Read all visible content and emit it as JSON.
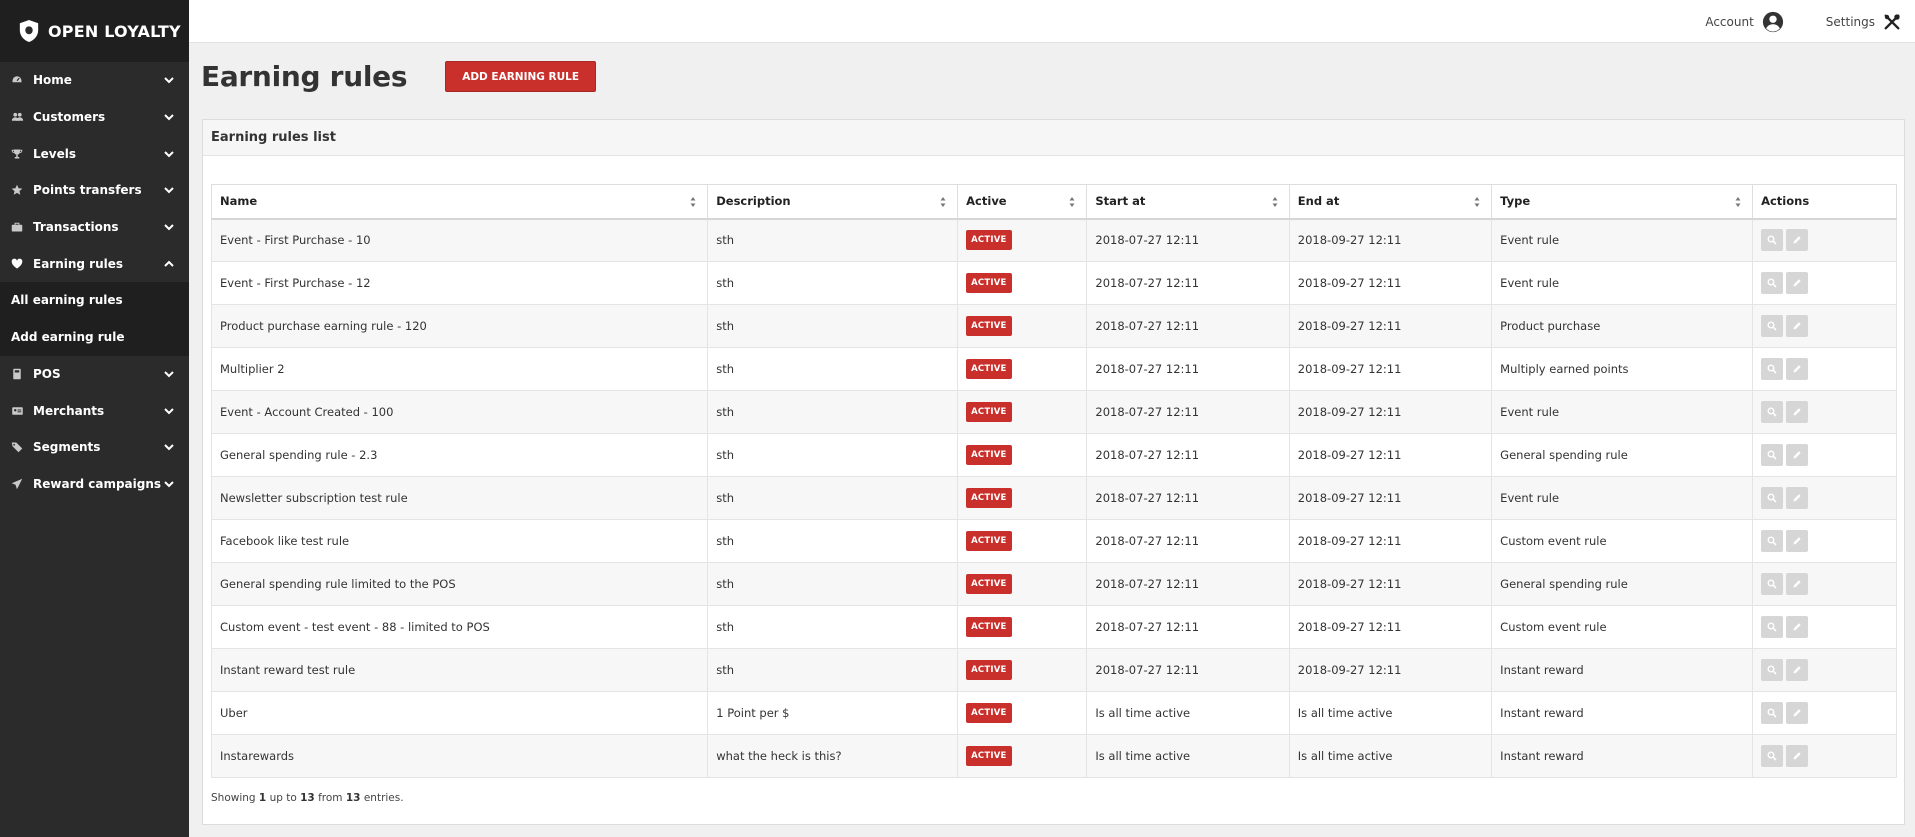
{
  "brand": {
    "name": "OPEN LOYALTY"
  },
  "colors": {
    "accent": "#c9302c",
    "sidebar_bg": "#2b2b2b",
    "sidebar_active_bg": "#1f1f1f"
  },
  "topbar": {
    "account_label": "Account",
    "settings_label": "Settings"
  },
  "sidebar": {
    "items": [
      {
        "label": "Home",
        "icon": "dashboard-icon"
      },
      {
        "label": "Customers",
        "icon": "users-icon"
      },
      {
        "label": "Levels",
        "icon": "trophy-icon"
      },
      {
        "label": "Points transfers",
        "icon": "star-icon"
      },
      {
        "label": "Transactions",
        "icon": "briefcase-icon"
      },
      {
        "label": "Earning rules",
        "icon": "heart-icon",
        "expanded": true
      },
      {
        "label": "POS",
        "icon": "pos-icon"
      },
      {
        "label": "Merchants",
        "icon": "id-card-icon"
      },
      {
        "label": "Segments",
        "icon": "tags-icon"
      },
      {
        "label": "Reward campaigns",
        "icon": "paper-plane-icon"
      }
    ],
    "subitems": [
      {
        "label": "All earning rules"
      },
      {
        "label": "Add earning rule"
      }
    ]
  },
  "page": {
    "title": "Earning rules",
    "add_button": "ADD EARNING RULE"
  },
  "panel": {
    "title": "Earning rules list"
  },
  "table": {
    "columns": [
      "Name",
      "Description",
      "Active",
      "Start at",
      "End at",
      "Type",
      "Actions"
    ],
    "rows": [
      {
        "name": "Event - First Purchase - 10",
        "description": "sth",
        "active": "ACTIVE",
        "start": "2018-07-27 12:11",
        "end": "2018-09-27 12:11",
        "type": "Event rule"
      },
      {
        "name": "Event - First Purchase - 12",
        "description": "sth",
        "active": "ACTIVE",
        "start": "2018-07-27 12:11",
        "end": "2018-09-27 12:11",
        "type": "Event rule"
      },
      {
        "name": "Product purchase earning rule - 120",
        "description": "sth",
        "active": "ACTIVE",
        "start": "2018-07-27 12:11",
        "end": "2018-09-27 12:11",
        "type": "Product purchase"
      },
      {
        "name": "Multiplier 2",
        "description": "sth",
        "active": "ACTIVE",
        "start": "2018-07-27 12:11",
        "end": "2018-09-27 12:11",
        "type": "Multiply earned points"
      },
      {
        "name": "Event - Account Created - 100",
        "description": "sth",
        "active": "ACTIVE",
        "start": "2018-07-27 12:11",
        "end": "2018-09-27 12:11",
        "type": "Event rule"
      },
      {
        "name": "General spending rule - 2.3",
        "description": "sth",
        "active": "ACTIVE",
        "start": "2018-07-27 12:11",
        "end": "2018-09-27 12:11",
        "type": "General spending rule"
      },
      {
        "name": "Newsletter subscription test rule",
        "description": "sth",
        "active": "ACTIVE",
        "start": "2018-07-27 12:11",
        "end": "2018-09-27 12:11",
        "type": "Event rule"
      },
      {
        "name": "Facebook like test rule",
        "description": "sth",
        "active": "ACTIVE",
        "start": "2018-07-27 12:11",
        "end": "2018-09-27 12:11",
        "type": "Custom event rule"
      },
      {
        "name": "General spending rule limited to the POS",
        "description": "sth",
        "active": "ACTIVE",
        "start": "2018-07-27 12:11",
        "end": "2018-09-27 12:11",
        "type": "General spending rule"
      },
      {
        "name": "Custom event - test event - 88 - limited to POS",
        "description": "sth",
        "active": "ACTIVE",
        "start": "2018-07-27 12:11",
        "end": "2018-09-27 12:11",
        "type": "Custom event rule"
      },
      {
        "name": "Instant reward test rule",
        "description": "sth",
        "active": "ACTIVE",
        "start": "2018-07-27 12:11",
        "end": "2018-09-27 12:11",
        "type": "Instant reward"
      },
      {
        "name": "Uber",
        "description": "1 Point per $",
        "active": "ACTIVE",
        "start": "Is all time active",
        "end": "Is all time active",
        "type": "Instant reward"
      },
      {
        "name": "Instarewards",
        "description": "what the heck is this?",
        "active": "ACTIVE",
        "start": "Is all time active",
        "end": "Is all time active",
        "type": "Instant reward"
      }
    ]
  },
  "footer": {
    "prefix": "Showing",
    "from_num": "1",
    "middle1": "up to",
    "to_num": "13",
    "middle2": "from",
    "total": "13",
    "suffix": "entries."
  }
}
